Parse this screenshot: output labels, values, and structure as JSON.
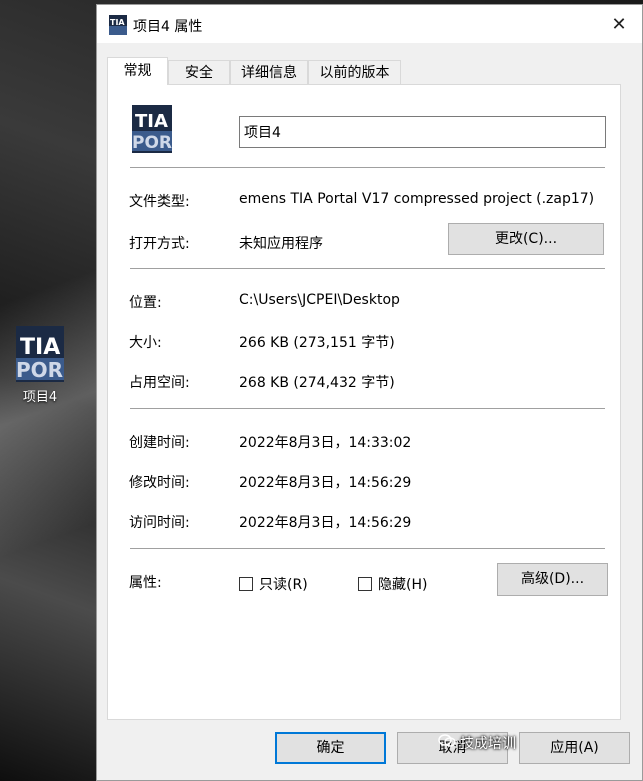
{
  "desktop": {
    "icon_label": "项目4",
    "icon_text_top": "TIA",
    "icon_text_bottom": "POR"
  },
  "dialog": {
    "title": "项目4 属性",
    "close": "✕",
    "tabs": [
      {
        "label": "常规",
        "active": true
      },
      {
        "label": "安全",
        "active": false
      },
      {
        "label": "详细信息",
        "active": false
      },
      {
        "label": "以前的版本",
        "active": false
      }
    ],
    "name_value": "项目4",
    "fields": {
      "file_type_label": "文件类型:",
      "file_type_value": "emens TIA Portal V17 compressed project (.zap17)",
      "open_with_label": "打开方式:",
      "open_with_value": "未知应用程序",
      "change_button": "更改(C)...",
      "location_label": "位置:",
      "location_value": "C:\\Users\\JCPEI\\Desktop",
      "size_label": "大小:",
      "size_value": "266 KB (273,151 字节)",
      "size_on_disk_label": "占用空间:",
      "size_on_disk_value": "268 KB (274,432 字节)",
      "created_label": "创建时间:",
      "created_value": "2022年8月3日，14:33:02",
      "modified_label": "修改时间:",
      "modified_value": "2022年8月3日，14:56:29",
      "accessed_label": "访问时间:",
      "accessed_value": "2022年8月3日，14:56:29",
      "attributes_label": "属性:",
      "readonly_label": "只读(R)",
      "hidden_label": "隐藏(H)",
      "advanced_button": "高级(D)..."
    },
    "ok_button": "确定",
    "cancel_button": "取消",
    "apply_button": "应用(A)"
  },
  "watermark": "技成培训",
  "colors": {
    "accent_border": "#0078d7",
    "tia_blue": "#3b5b8c"
  }
}
